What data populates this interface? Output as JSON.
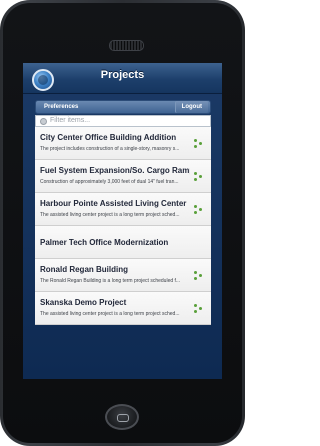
{
  "navbar": {
    "title": "Projects"
  },
  "toolbar": {
    "preferences_label": "Preferences",
    "logout_label": "Logout"
  },
  "filter": {
    "placeholder": "Filter items..."
  },
  "projects": [
    {
      "title": "City Center Office Building Addition",
      "description": "The project includes construction of a single-story, masonry s..."
    },
    {
      "title": "Fuel System Expansion/So. Cargo Ramp",
      "description": "Construction of approximately 3,000 feet of dual 14\" fuel tran..."
    },
    {
      "title": "Harbour Pointe Assisted Living Center",
      "description": "The assisted living center project is a long term project sched..."
    },
    {
      "title": "Palmer Tech Office Modernization",
      "description": ""
    },
    {
      "title": "Ronald Regan Building",
      "description": "The Ronald Regan Building is a long term project scheduled f..."
    },
    {
      "title": "Skanska Demo Project",
      "description": "The assisted living center project is a long term project sched..."
    }
  ],
  "colors": {
    "accent": "#1d3f6b",
    "action_icon": "#5aa03a"
  }
}
